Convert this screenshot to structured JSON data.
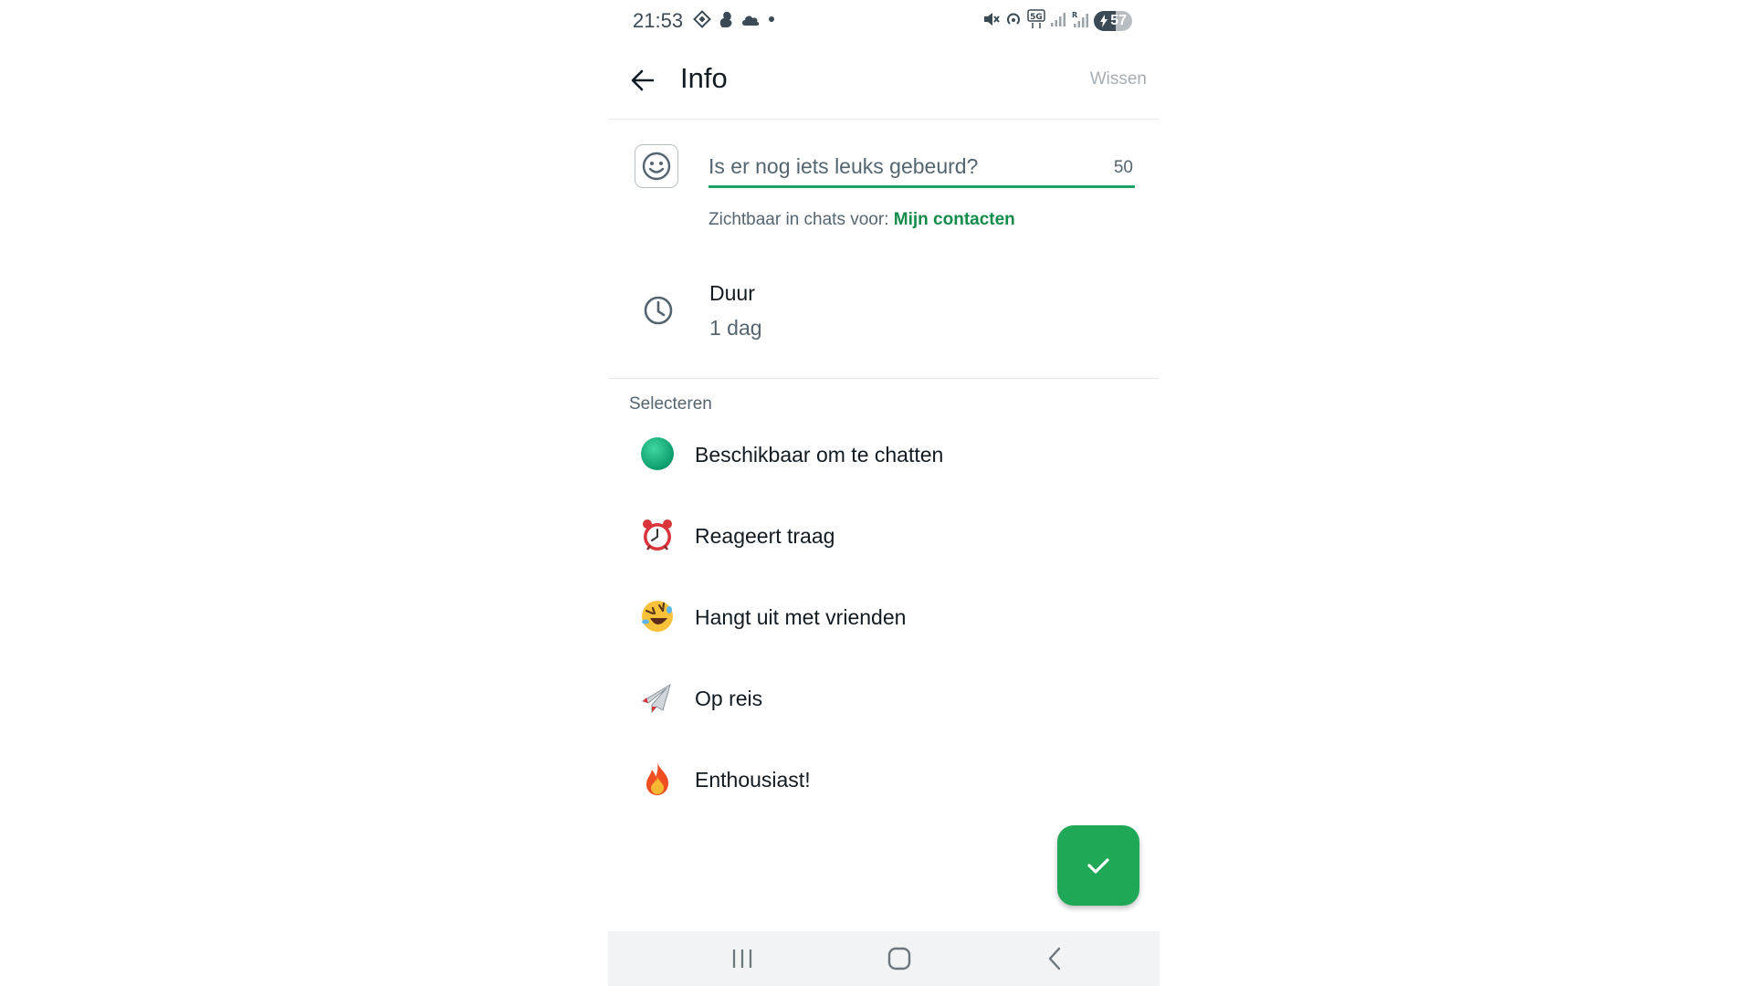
{
  "status_bar": {
    "time": "21:53",
    "battery": "57",
    "left_icons": [
      "signal-app-icon",
      "squirrel-icon",
      "cloud-icon",
      "dot-icon"
    ],
    "right_icons": [
      "mute-icon",
      "hotspot-icon",
      "5g-icon",
      "signal-bars-icon",
      "roaming-signal-icon",
      "battery-charging-icon"
    ]
  },
  "app_bar": {
    "title": "Info",
    "clear_label": "Wissen"
  },
  "status_input": {
    "value": "Is er nog iets leuks gebeurd?",
    "remaining_chars": "50",
    "visibility_prefix": "Zichtbaar in chats voor: ",
    "visibility_value": "Mijn contacten"
  },
  "duration": {
    "label": "Duur",
    "value": "1 dag"
  },
  "select_section": {
    "title": "Selecteren",
    "options": [
      {
        "icon": "green-circle-icon",
        "label": "Beschikbaar om te chatten"
      },
      {
        "icon": "alarm-clock-icon",
        "label": "Reageert traag"
      },
      {
        "icon": "laughing-face-icon",
        "label": "Hangt uit met vrienden"
      },
      {
        "icon": "airplane-icon",
        "label": "Op reis"
      },
      {
        "icon": "fire-icon",
        "label": "Enthousiast!"
      }
    ]
  },
  "colors": {
    "accent_green": "#1fa855",
    "link_green": "#128c4a",
    "input_underline": "#1aa163"
  },
  "nav_bar": [
    "recent-apps-icon",
    "home-icon",
    "back-nav-icon"
  ]
}
